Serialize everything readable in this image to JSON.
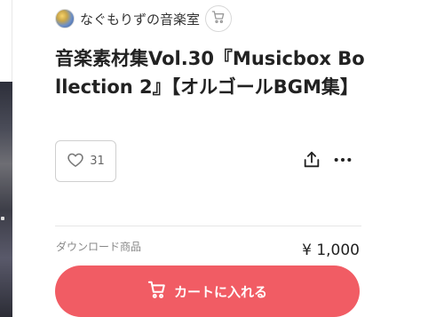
{
  "creator": {
    "name": "なぐもりずの音楽室",
    "avatar_icon": "creator-avatar",
    "shop_icon": "cart-icon"
  },
  "product": {
    "title": "音楽素材集Vol.30『Musicbox Bollection 2』【オルゴールBGM集】",
    "type_label": "ダウンロード商品",
    "price": "¥ 1,000"
  },
  "actions": {
    "like_count": "31",
    "like_icon": "heart-icon",
    "share_icon": "share-icon",
    "more_icon": "more-icon"
  },
  "cart": {
    "label": "カートに入れる",
    "icon": "cart-icon",
    "color": "#f15c64"
  }
}
